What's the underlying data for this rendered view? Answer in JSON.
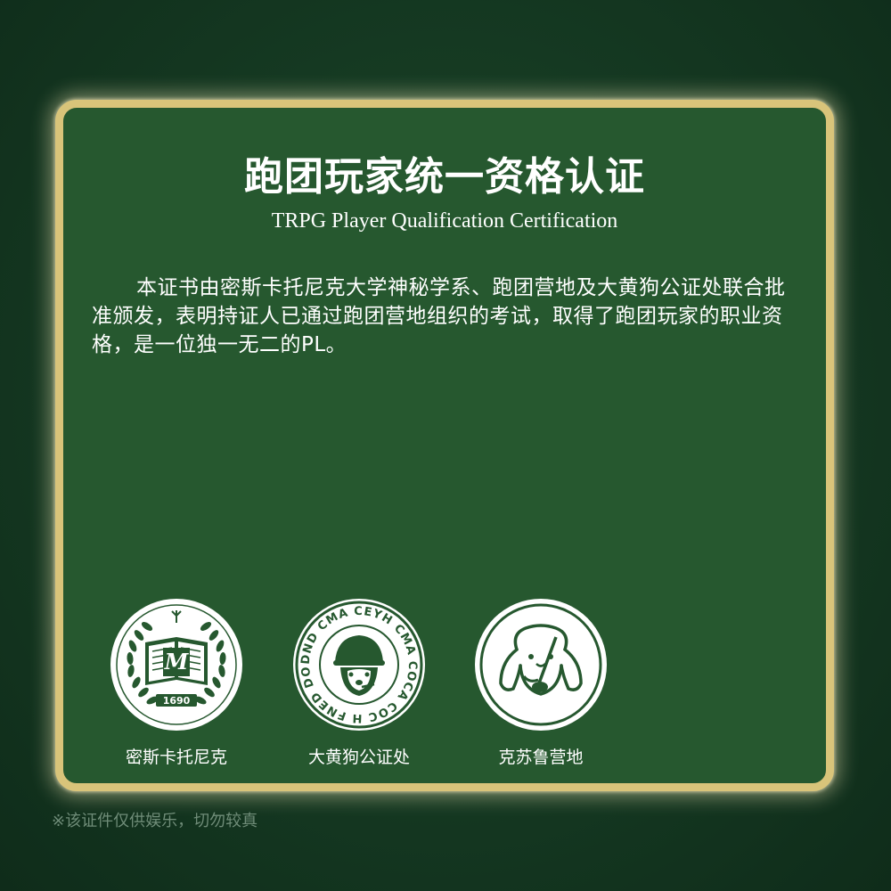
{
  "certificate": {
    "title": "跑团玩家统一资格认证",
    "subtitle": "TRPG Player Qualification Certification",
    "body": "本证书由密斯卡托尼克大学神秘学系、跑团营地及大黄狗公证处联合批准颁发，表明持证人已通过跑团营地组织的考试，取得了跑团玩家的职业资格，是一位独一无二的PL。"
  },
  "seals": [
    {
      "label": "密斯卡托尼克",
      "icon": "miskatonic-university-seal-icon",
      "year": "1690",
      "monogram": "M"
    },
    {
      "label": "大黄狗公证处",
      "icon": "yellow-dog-notary-seal-icon",
      "ring_text": "DND CMA CEYH CMA COCA COC H FNED DOA"
    },
    {
      "label": "克苏鲁营地",
      "icon": "cthulhu-camp-seal-icon"
    }
  ],
  "disclaimer": "※该证件仅供娱乐，切勿较真",
  "colors": {
    "background": "#163b23",
    "card": "#26582f",
    "border": "#d9c47a",
    "text": "#ffffff",
    "disclaimer": "#6f8c78"
  }
}
